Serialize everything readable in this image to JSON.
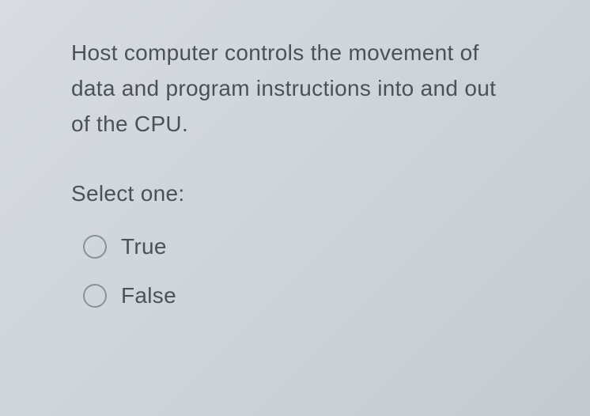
{
  "question": {
    "text": "Host computer controls the movement of data and program instructions into and out of the CPU.",
    "prompt": "Select one:",
    "options": [
      {
        "label": "True",
        "selected": false
      },
      {
        "label": "False",
        "selected": false
      }
    ]
  }
}
